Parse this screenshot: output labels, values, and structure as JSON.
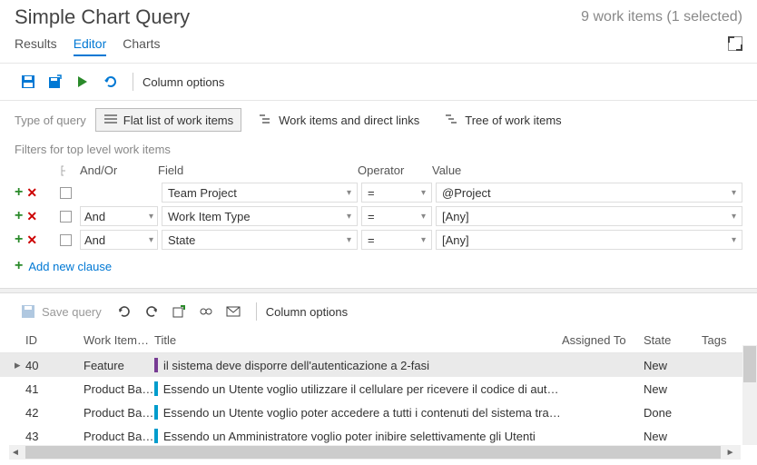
{
  "header": {
    "title": "Simple Chart Query",
    "status": "9 work items (1 selected)"
  },
  "tabs": {
    "results": "Results",
    "editor": "Editor",
    "charts": "Charts"
  },
  "toolbar": {
    "column_options": "Column options"
  },
  "query_type": {
    "label": "Type of query",
    "flat": "Flat list of work items",
    "links": "Work items and direct links",
    "tree": "Tree of work items"
  },
  "filters": {
    "label": "Filters for top level work items",
    "headers": {
      "andor": "And/Or",
      "field": "Field",
      "operator": "Operator",
      "value": "Value"
    },
    "rows": [
      {
        "andor": "",
        "field": "Team Project",
        "op": "=",
        "value": "@Project"
      },
      {
        "andor": "And",
        "field": "Work Item Type",
        "op": "=",
        "value": "[Any]"
      },
      {
        "andor": "And",
        "field": "State",
        "op": "=",
        "value": "[Any]"
      }
    ],
    "add_clause": "Add new clause"
  },
  "results_toolbar": {
    "save": "Save query",
    "column_options": "Column options"
  },
  "results": {
    "headers": {
      "id": "ID",
      "type": "Work Item…",
      "title": "Title",
      "assigned": "Assigned To",
      "state": "State",
      "tags": "Tags"
    },
    "rows": [
      {
        "id": "40",
        "type": "Feature",
        "color": "purple",
        "title": "il sistema deve disporre dell'autenticazione a 2-fasi",
        "state": "New",
        "selected": true
      },
      {
        "id": "41",
        "type": "Product Ba…",
        "color": "teal",
        "title": "Essendo un Utente voglio utilizzare il cellulare per ricevere il codice di autentica…",
        "state": "New",
        "selected": false
      },
      {
        "id": "42",
        "type": "Product Ba…",
        "color": "teal",
        "title": "Essendo un Utente voglio poter accedere a tutti i contenuti del sistema tramite …",
        "state": "Done",
        "selected": false
      },
      {
        "id": "43",
        "type": "Product Ba…",
        "color": "teal",
        "title": "Essendo un Amministratore voglio poter inibire selettivamente gli Utenti",
        "state": "New",
        "selected": false
      }
    ]
  }
}
